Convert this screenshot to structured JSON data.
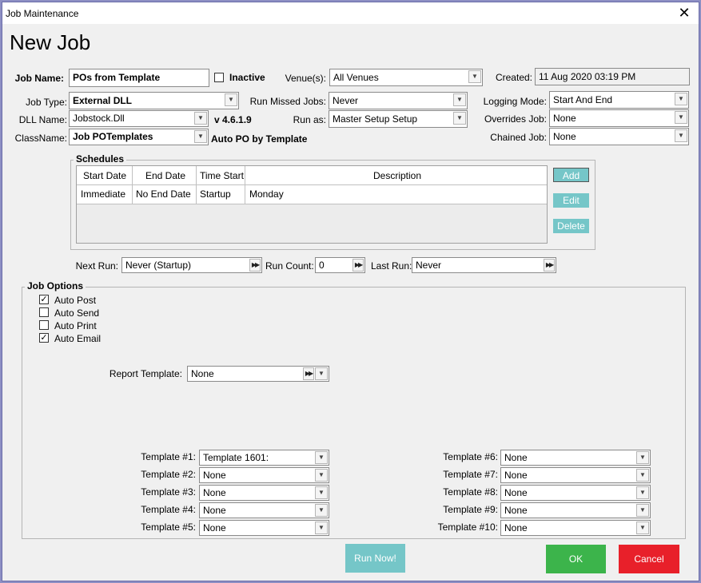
{
  "window": {
    "title": "Job Maintenance",
    "close_glyph": "✕"
  },
  "page_title": "New Job",
  "job_name": {
    "label": "Job Name:",
    "value": "POs from Template"
  },
  "inactive": {
    "label": "Inactive",
    "checked": false
  },
  "venues": {
    "label": "Venue(s):",
    "value": "All Venues"
  },
  "created": {
    "label": "Created:",
    "value": "11 Aug 2020 03:19 PM"
  },
  "job_type": {
    "label": "Job Type:",
    "value": "External DLL"
  },
  "run_missed_jobs": {
    "label": "Run Missed Jobs:",
    "value": "Never"
  },
  "logging_mode": {
    "label": "Logging Mode:",
    "value": "Start And End"
  },
  "dll_name": {
    "label": "DLL Name:",
    "value": "Jobstock.Dll",
    "version": "v 4.6.1.9"
  },
  "run_as": {
    "label": "Run as:",
    "value": "Master Setup  Setup"
  },
  "overrides_job": {
    "label": "Overrides Job:",
    "value": "None"
  },
  "class_name": {
    "label": "ClassName:",
    "value": "Job POTemplates",
    "description": "Auto PO by Template"
  },
  "chained_job": {
    "label": "Chained Job:",
    "value": "None"
  },
  "schedules": {
    "legend": "Schedules",
    "columns": [
      "Start Date",
      "End Date",
      "Time Start",
      "Description"
    ],
    "rows": [
      [
        "Immediate",
        "No End Date",
        "Startup",
        "Monday"
      ]
    ],
    "buttons": {
      "add": "Add",
      "edit": "Edit",
      "delete": "Delete"
    }
  },
  "next_run": {
    "label": "Next Run:",
    "value": "Never (Startup)"
  },
  "run_count": {
    "label": "Run Count:",
    "value": "0"
  },
  "last_run": {
    "label": "Last Run:",
    "value": "Never"
  },
  "job_options": {
    "legend": "Job Options",
    "auto_post": {
      "label": "Auto Post",
      "checked": true
    },
    "auto_send": {
      "label": "Auto Send",
      "checked": false
    },
    "auto_print": {
      "label": "Auto Print",
      "checked": false
    },
    "auto_email": {
      "label": "Auto Email",
      "checked": true
    },
    "report_template": {
      "label": "Report Template:",
      "value": "None"
    }
  },
  "templates": {
    "t1": {
      "label": "Template #1:",
      "value": "Template 1601:"
    },
    "t2": {
      "label": "Template #2:",
      "value": "None"
    },
    "t3": {
      "label": "Template #3:",
      "value": "None"
    },
    "t4": {
      "label": "Template #4:",
      "value": "None"
    },
    "t5": {
      "label": "Template #5:",
      "value": "None"
    },
    "t6": {
      "label": "Template #6:",
      "value": "None"
    },
    "t7": {
      "label": "Template #7:",
      "value": "None"
    },
    "t8": {
      "label": "Template #8:",
      "value": "None"
    },
    "t9": {
      "label": "Template #9:",
      "value": "None"
    },
    "t10": {
      "label": "Template #10:",
      "value": "None"
    }
  },
  "footer": {
    "run_now": "Run Now!",
    "ok": "OK",
    "cancel": "Cancel"
  },
  "colors": {
    "teal": "#75c6c8",
    "ok_green": "#3cb44b",
    "cancel_red": "#e8202a",
    "frame": "#8d8fc4"
  },
  "glyphs": {
    "check": "✓",
    "dropdown": "▼",
    "fast_forward": "▶▶"
  }
}
